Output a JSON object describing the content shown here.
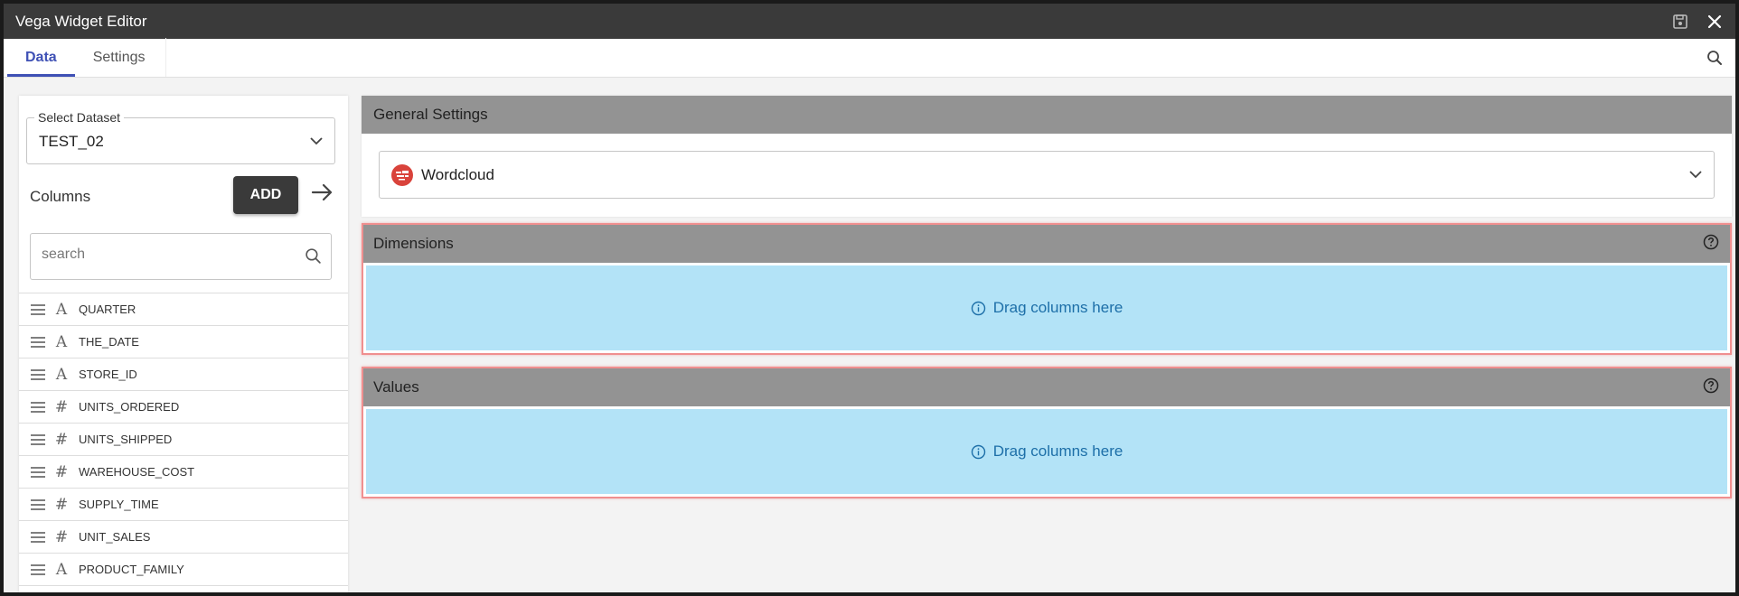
{
  "window": {
    "title": "Vega Widget Editor"
  },
  "tabs": [
    {
      "label": "Data",
      "active": true
    },
    {
      "label": "Settings",
      "active": false
    }
  ],
  "dataset": {
    "legend": "Select Dataset",
    "value": "TEST_02"
  },
  "columns": {
    "label": "Columns",
    "add_label": "ADD",
    "search_placeholder": "search",
    "items": [
      {
        "name": "QUARTER",
        "type": "A"
      },
      {
        "name": "THE_DATE",
        "type": "A"
      },
      {
        "name": "STORE_ID",
        "type": "A"
      },
      {
        "name": "UNITS_ORDERED",
        "type": "#"
      },
      {
        "name": "UNITS_SHIPPED",
        "type": "#"
      },
      {
        "name": "WAREHOUSE_COST",
        "type": "#"
      },
      {
        "name": "SUPPLY_TIME",
        "type": "#"
      },
      {
        "name": "UNIT_SALES",
        "type": "#"
      },
      {
        "name": "PRODUCT_FAMILY",
        "type": "A"
      }
    ]
  },
  "general_settings": {
    "title": "General Settings",
    "chart_type": "Wordcloud"
  },
  "dimensions": {
    "title": "Dimensions",
    "placeholder": "Drag columns here"
  },
  "values": {
    "title": "Values",
    "placeholder": "Drag columns here"
  },
  "colors": {
    "accent": "#3f51b5",
    "titlebar": "#3a3a3a",
    "drop_zone": "#b3e3f7",
    "zone_border": "#f08f8f"
  }
}
